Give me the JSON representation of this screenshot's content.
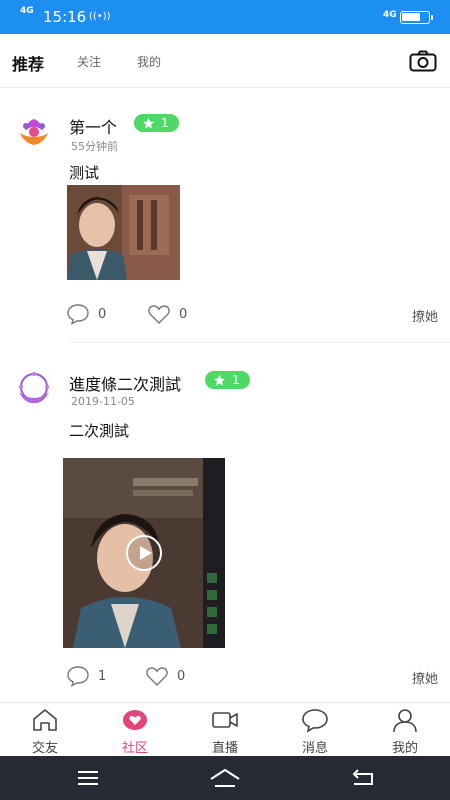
{
  "status_bar": {
    "network": "4G",
    "time": "15:16",
    "network_right": "4G",
    "battery_percent": 70
  },
  "top_tabs": [
    {
      "label": "推荐"
    },
    {
      "label": "关注"
    },
    {
      "label": "我的"
    }
  ],
  "posts": [
    {
      "username": "第一个",
      "level": "1",
      "time": "55分钟前",
      "text": "测试",
      "comments": "0",
      "likes": "0",
      "flirt_label": "撩她"
    },
    {
      "username": "進度條二次測試",
      "level": "1",
      "time": "2019-11-05",
      "text": "二次測試",
      "comments": "1",
      "likes": "0",
      "flirt_label": "撩她"
    }
  ],
  "bottom_nav": [
    {
      "label": "交友",
      "icon": "home-icon"
    },
    {
      "label": "社区",
      "icon": "community-heart-icon",
      "active": true
    },
    {
      "label": "直播",
      "icon": "video-camera-icon"
    },
    {
      "label": "消息",
      "icon": "message-bubble-icon"
    },
    {
      "label": "我的",
      "icon": "person-icon"
    }
  ],
  "colors": {
    "status_bar": "#1e8ff2",
    "badge": "#4cd964",
    "active_tab": "#e2457a",
    "system_nav": "#262b33"
  }
}
